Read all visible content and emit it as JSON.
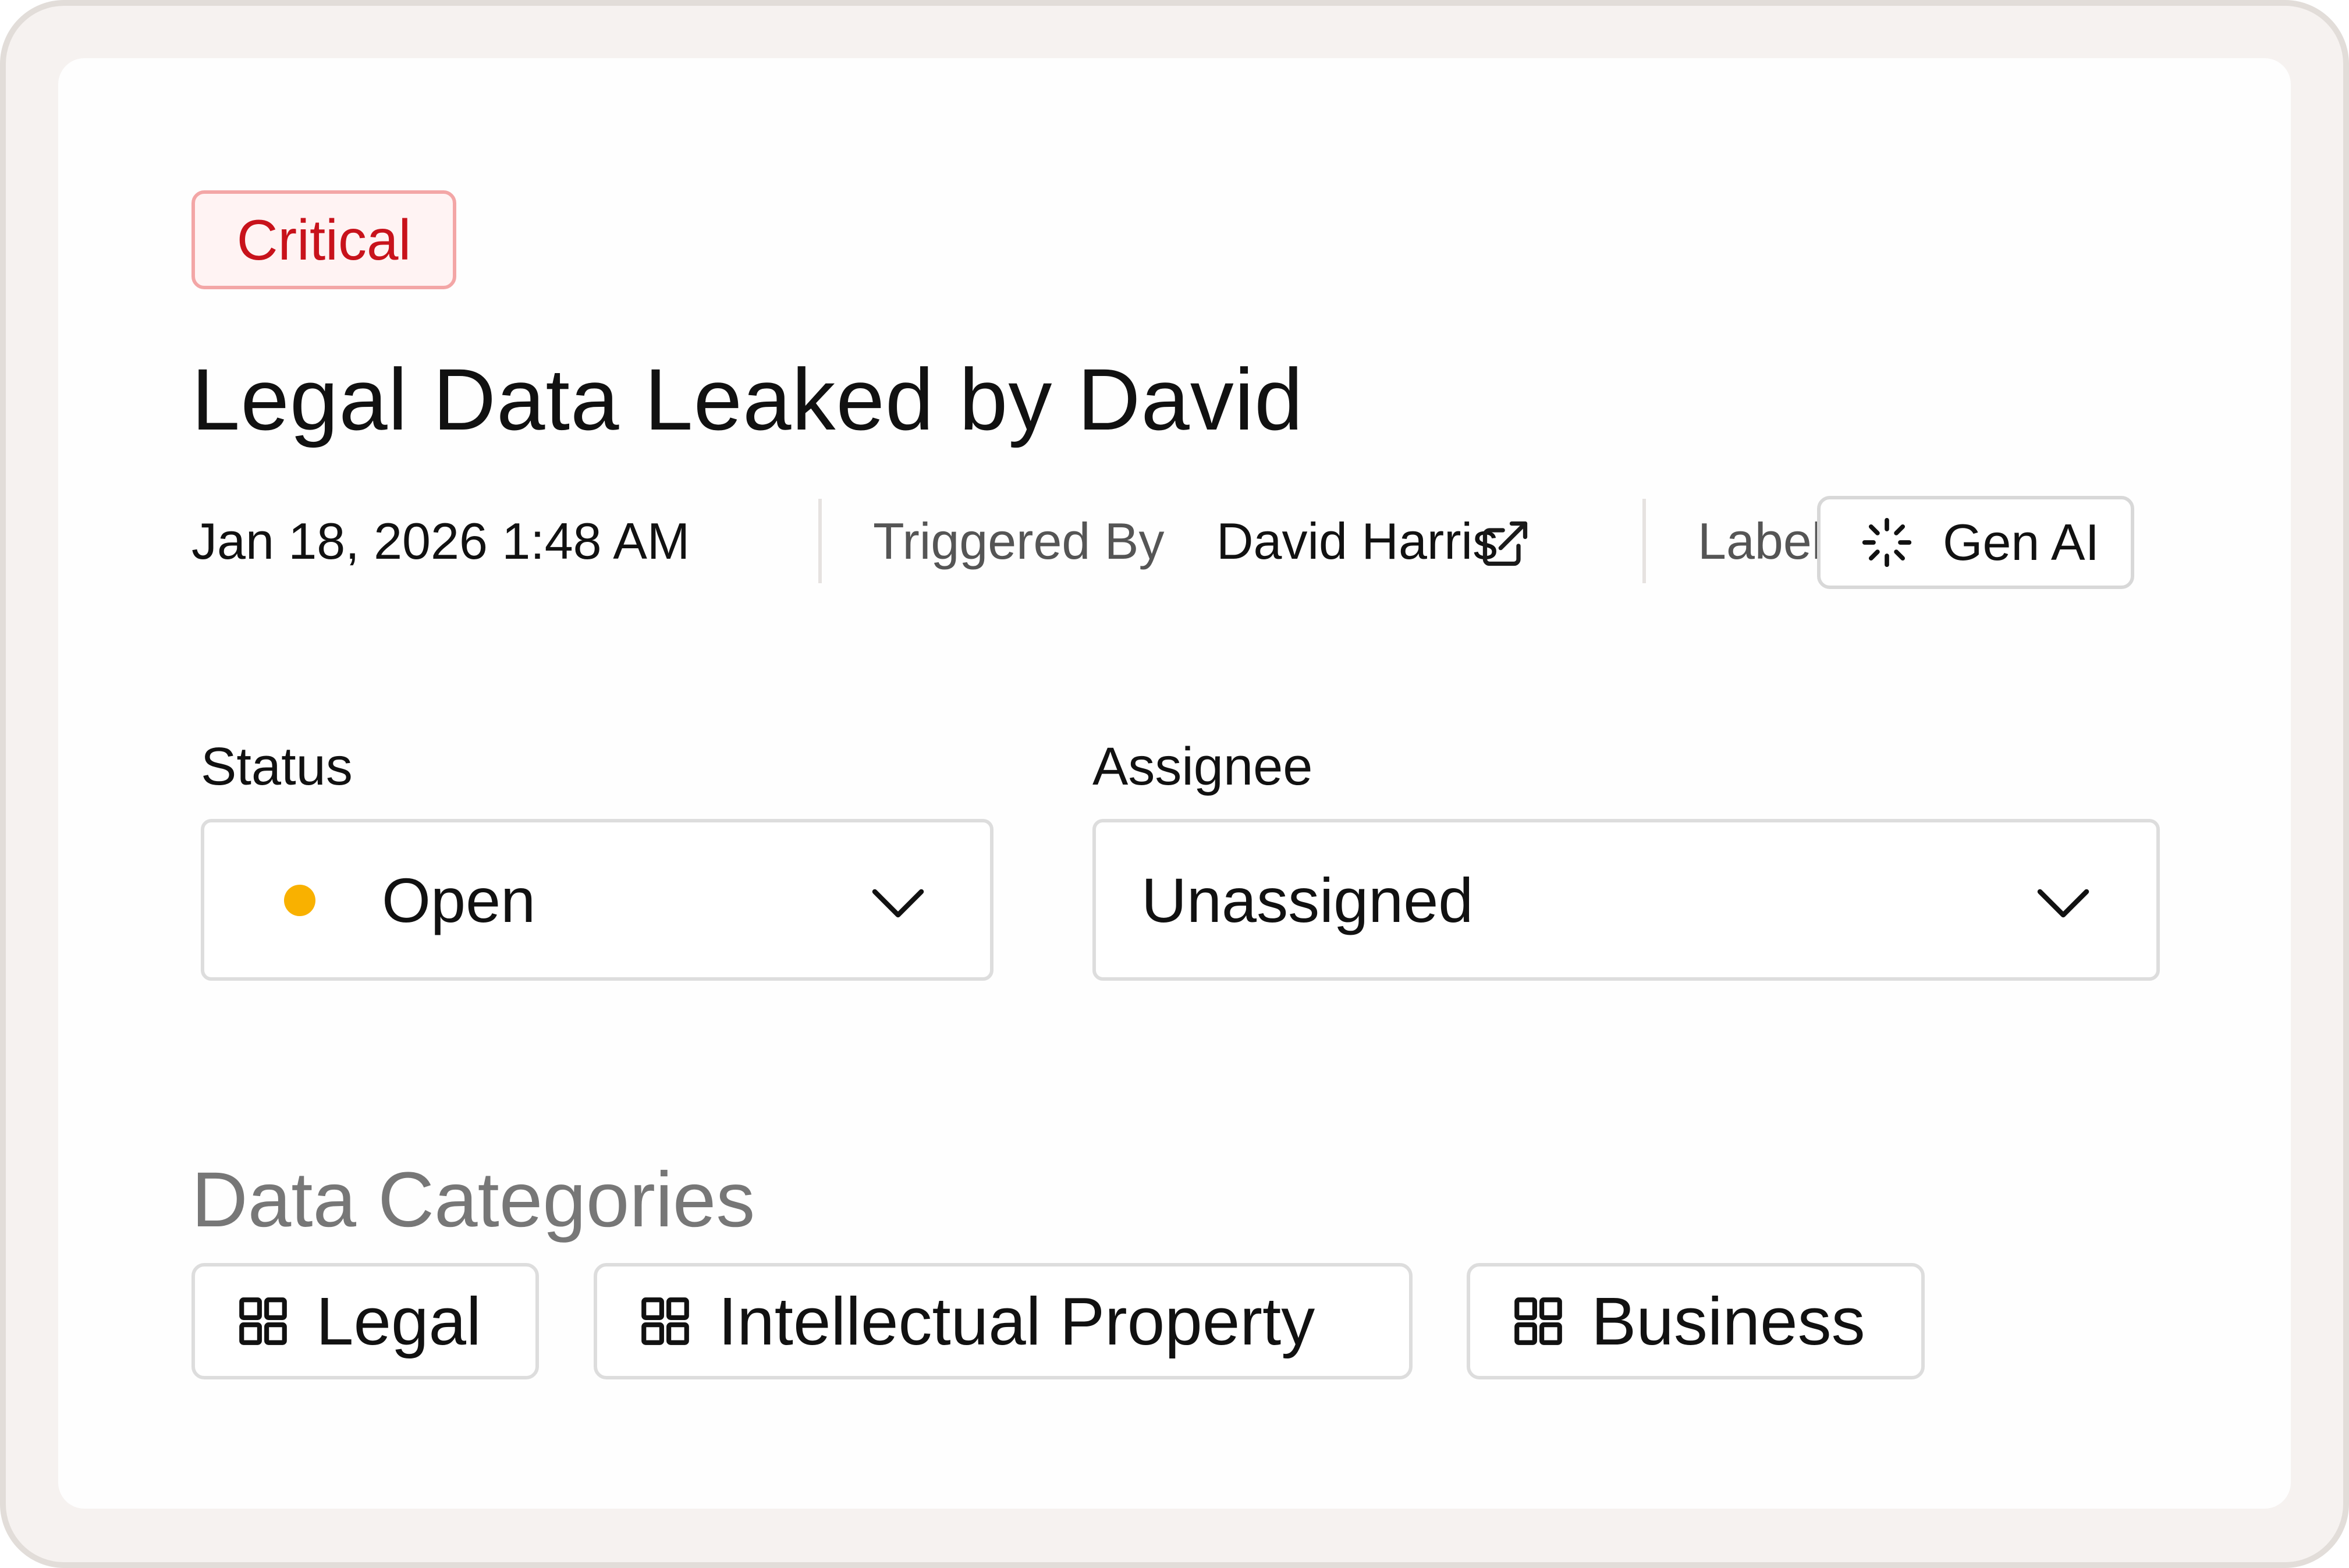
{
  "alert": {
    "severity": "Critical",
    "title": "Legal Data Leaked by David",
    "timestamp": "Jan 18, 2026 1:48 AM",
    "triggered_by_label": "Triggered By",
    "triggered_by_name": "David Harris",
    "label_prefix": "Label:",
    "label_value": "Gen AI",
    "label_icon": "sparkle-loader-icon"
  },
  "status": {
    "label": "Status",
    "value": "Open",
    "dot_color": "#F9B100"
  },
  "assignee": {
    "label": "Assignee",
    "value": "Unassigned"
  },
  "data_categories": {
    "title": "Data Categories",
    "items": [
      {
        "label": "Legal",
        "icon": "grid-icon"
      },
      {
        "label": "Intellectual Property",
        "icon": "grid-icon"
      },
      {
        "label": "Business",
        "icon": "grid-icon"
      }
    ]
  },
  "colors": {
    "critical_text": "#C8121B",
    "critical_border": "#F3A6A6",
    "critical_bg": "#FFF3F3"
  }
}
